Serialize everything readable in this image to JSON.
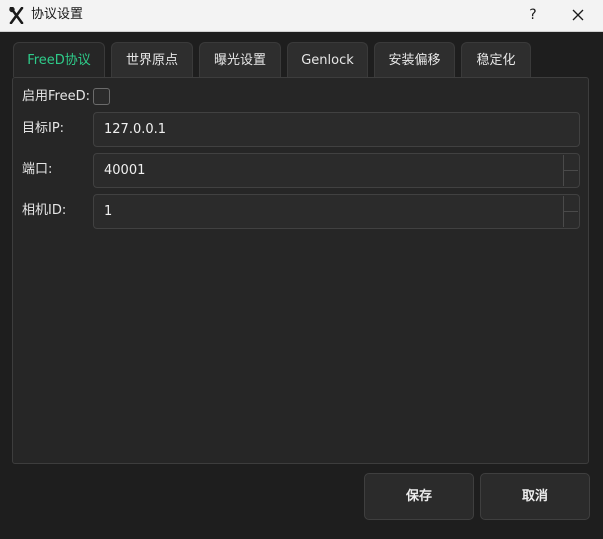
{
  "window": {
    "title": "协议设置",
    "help": "?",
    "app_icon": "tool-x-icon",
    "close_icon": "close-icon"
  },
  "tabs": [
    {
      "label": "FreeD协议",
      "active": true
    },
    {
      "label": "世界原点",
      "active": false
    },
    {
      "label": "曝光设置",
      "active": false
    },
    {
      "label": "Genlock",
      "active": false
    },
    {
      "label": "安装偏移",
      "active": false
    },
    {
      "label": "稳定化",
      "active": false
    }
  ],
  "form": {
    "enable_label": "启用FreeD:",
    "enable_checked": false,
    "target_ip_label": "目标IP:",
    "target_ip_value": "127.0.0.1",
    "port_label": "端口:",
    "port_value": "40001",
    "camera_id_label": "相机ID:",
    "camera_id_value": "1"
  },
  "buttons": {
    "save": "保存",
    "cancel": "取消"
  },
  "colors": {
    "accent": "#2ecc8a",
    "background": "#1e1e1e",
    "panel": "#262626",
    "titlebar": "#f3f3f3"
  }
}
